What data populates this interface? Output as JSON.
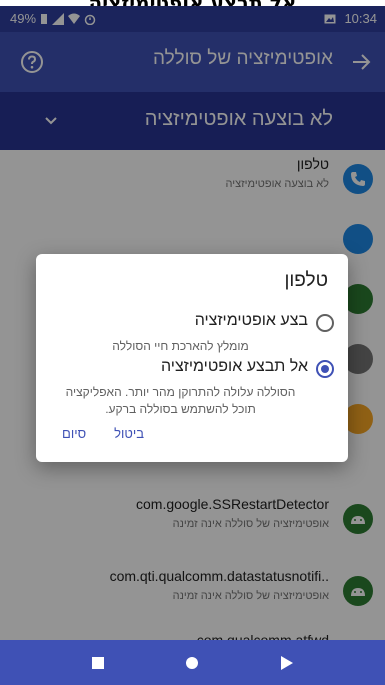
{
  "caption": "אל תבצע אופטימיזציה",
  "status_bar": {
    "battery": "49%",
    "time": "10:34"
  },
  "toolbar": {
    "title": "אופטימיזציה של סוללה"
  },
  "filter": {
    "selected": "לא בוצעה אופטימיזציה"
  },
  "list": {
    "items": [
      {
        "title": "טלפון",
        "subtitle": "לא בוצעה אופטימיזציה",
        "icon": "phone-icon",
        "color": "#1e88e5"
      },
      {
        "title": "com.google.SSRestartDetector",
        "subtitle": "אופטימיזציה של סוללה אינה זמינה",
        "icon": "android-icon",
        "color": "#2e7d32"
      },
      {
        "title": "com.qti.qualcomm.datastatusnotifi..",
        "subtitle": "אופטימיזציה של סוללה אינה זמינה",
        "icon": "android-icon",
        "color": "#2e7d32"
      },
      {
        "title": "com.qualcomm.atfwd",
        "subtitle": "",
        "icon": "android-icon",
        "color": "#2e7d32"
      }
    ]
  },
  "dialog": {
    "title": "טלפון",
    "options": [
      {
        "label": "בצע אופטימיזציה",
        "description": "מומלץ להארכת חיי הסוללה",
        "selected": false
      },
      {
        "label": "אל תבצע אופטימיזציה",
        "description": "הסוללה עלולה להתרוקן מהר יותר. האפליקציה תוכל להשתמש בסוללה ברקע.",
        "selected": true
      }
    ],
    "cancel_label": "ביטול",
    "done_label": "סיום"
  },
  "colors": {
    "primary": "#3f51b5",
    "primary_dark": "#303f9f",
    "selector": "#283593"
  }
}
